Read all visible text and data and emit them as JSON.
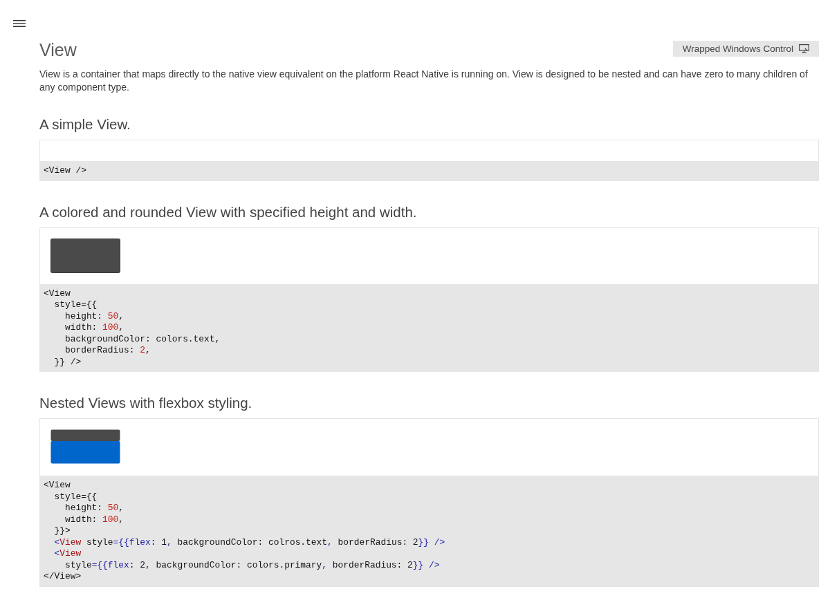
{
  "page": {
    "title": "View",
    "badge": {
      "label": "Wrapped Windows Control"
    },
    "description": "View is a container that maps directly to the native view equivalent on the platform React Native is running on. View is designed to be nested and can have zero to many children of any component type."
  },
  "examples": [
    {
      "heading": "A simple View.",
      "preview": {
        "kind": "empty"
      },
      "code": [
        [
          {
            "kind": "plain",
            "text": "<View />"
          }
        ]
      ]
    },
    {
      "heading": "A colored and rounded View with specified height and width.",
      "preview": {
        "kind": "box"
      },
      "code": [
        [
          {
            "kind": "plain",
            "text": "<View"
          }
        ],
        [
          {
            "kind": "plain",
            "text": "  style={{"
          }
        ],
        [
          {
            "kind": "plain",
            "text": "    height: "
          },
          {
            "kind": "number",
            "text": "50"
          },
          {
            "kind": "plain",
            "text": ","
          }
        ],
        [
          {
            "kind": "plain",
            "text": "    width: "
          },
          {
            "kind": "number",
            "text": "100"
          },
          {
            "kind": "plain",
            "text": ","
          }
        ],
        [
          {
            "kind": "plain",
            "text": "    backgroundColor: colors.text,"
          }
        ],
        [
          {
            "kind": "plain",
            "text": "    borderRadius: "
          },
          {
            "kind": "number",
            "text": "2"
          },
          {
            "kind": "plain",
            "text": ","
          }
        ],
        [
          {
            "kind": "plain",
            "text": "  }} />"
          }
        ]
      ]
    },
    {
      "heading": "Nested Views with flexbox styling.",
      "preview": {
        "kind": "nested"
      },
      "code": [
        [
          {
            "kind": "plain",
            "text": "<View"
          }
        ],
        [
          {
            "kind": "plain",
            "text": "  style={{"
          }
        ],
        [
          {
            "kind": "plain",
            "text": "    height: "
          },
          {
            "kind": "number",
            "text": "50"
          },
          {
            "kind": "plain",
            "text": ","
          }
        ],
        [
          {
            "kind": "plain",
            "text": "    width: "
          },
          {
            "kind": "number",
            "text": "100"
          },
          {
            "kind": "plain",
            "text": ","
          }
        ],
        [
          {
            "kind": "plain",
            "text": "  }}>"
          }
        ],
        [
          {
            "kind": "punct",
            "text": "  <"
          },
          {
            "kind": "tag",
            "text": "View"
          },
          {
            "kind": "plain",
            "text": " style"
          },
          {
            "kind": "punct",
            "text": "={{flex"
          },
          {
            "kind": "plain",
            "text": ": 1"
          },
          {
            "kind": "punct",
            "text": ","
          },
          {
            "kind": "plain",
            "text": " backgroundColor: colros.text"
          },
          {
            "kind": "punct",
            "text": ","
          },
          {
            "kind": "plain",
            "text": " borderRadius: 2"
          },
          {
            "kind": "punct",
            "text": "}} />"
          }
        ],
        [
          {
            "kind": "punct",
            "text": "  <"
          },
          {
            "kind": "tag",
            "text": "View"
          }
        ],
        [
          {
            "kind": "plain",
            "text": "    style"
          },
          {
            "kind": "punct",
            "text": "={{flex"
          },
          {
            "kind": "plain",
            "text": ": 2"
          },
          {
            "kind": "punct",
            "text": ","
          },
          {
            "kind": "plain",
            "text": " backgroundColor: colors.primary"
          },
          {
            "kind": "punct",
            "text": ","
          },
          {
            "kind": "plain",
            "text": " borderRadius: 2"
          },
          {
            "kind": "punct",
            "text": "}} />"
          }
        ],
        [
          {
            "kind": "plain",
            "text": "</View>"
          }
        ]
      ]
    }
  ]
}
